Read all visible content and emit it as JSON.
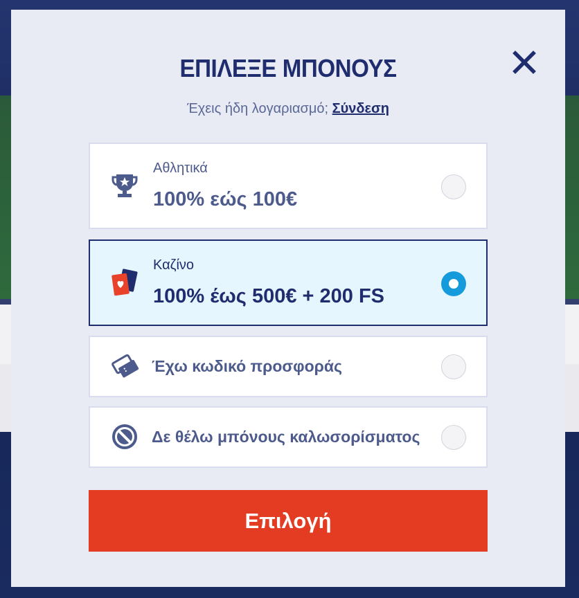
{
  "modal": {
    "title": "ΕΠΙΛΕΞΕ ΜΠΟΝΟΥΣ",
    "close_icon": "close-icon",
    "subtitle_text": "Έχεις ήδη λογαριασμό;",
    "login_link": "Σύνδεση",
    "submit_label": "Επιλογή"
  },
  "options": [
    {
      "icon": "trophy-icon",
      "category": "Αθλητικά",
      "value": "100% εώς 100€",
      "selected": false
    },
    {
      "icon": "playing-cards-icon",
      "category": "Καζίνο",
      "value": "100% έως 500€ + 200 FS",
      "selected": true
    },
    {
      "icon": "tickets-icon",
      "label": "Έχω κωδικό προσφοράς",
      "selected": false
    },
    {
      "icon": "no-entry-icon",
      "label": "Δε θέλω μπόνους καλωσορίσματος",
      "selected": false
    }
  ],
  "colors": {
    "modal_bg": "#e8eaf4",
    "navy": "#1f2d6e",
    "text_muted": "#4d5b8c",
    "selected_bg": "#e6f6fe",
    "radio_active": "#159bdc",
    "submit_bg": "#e33c23",
    "card_red": "#e8432a"
  }
}
